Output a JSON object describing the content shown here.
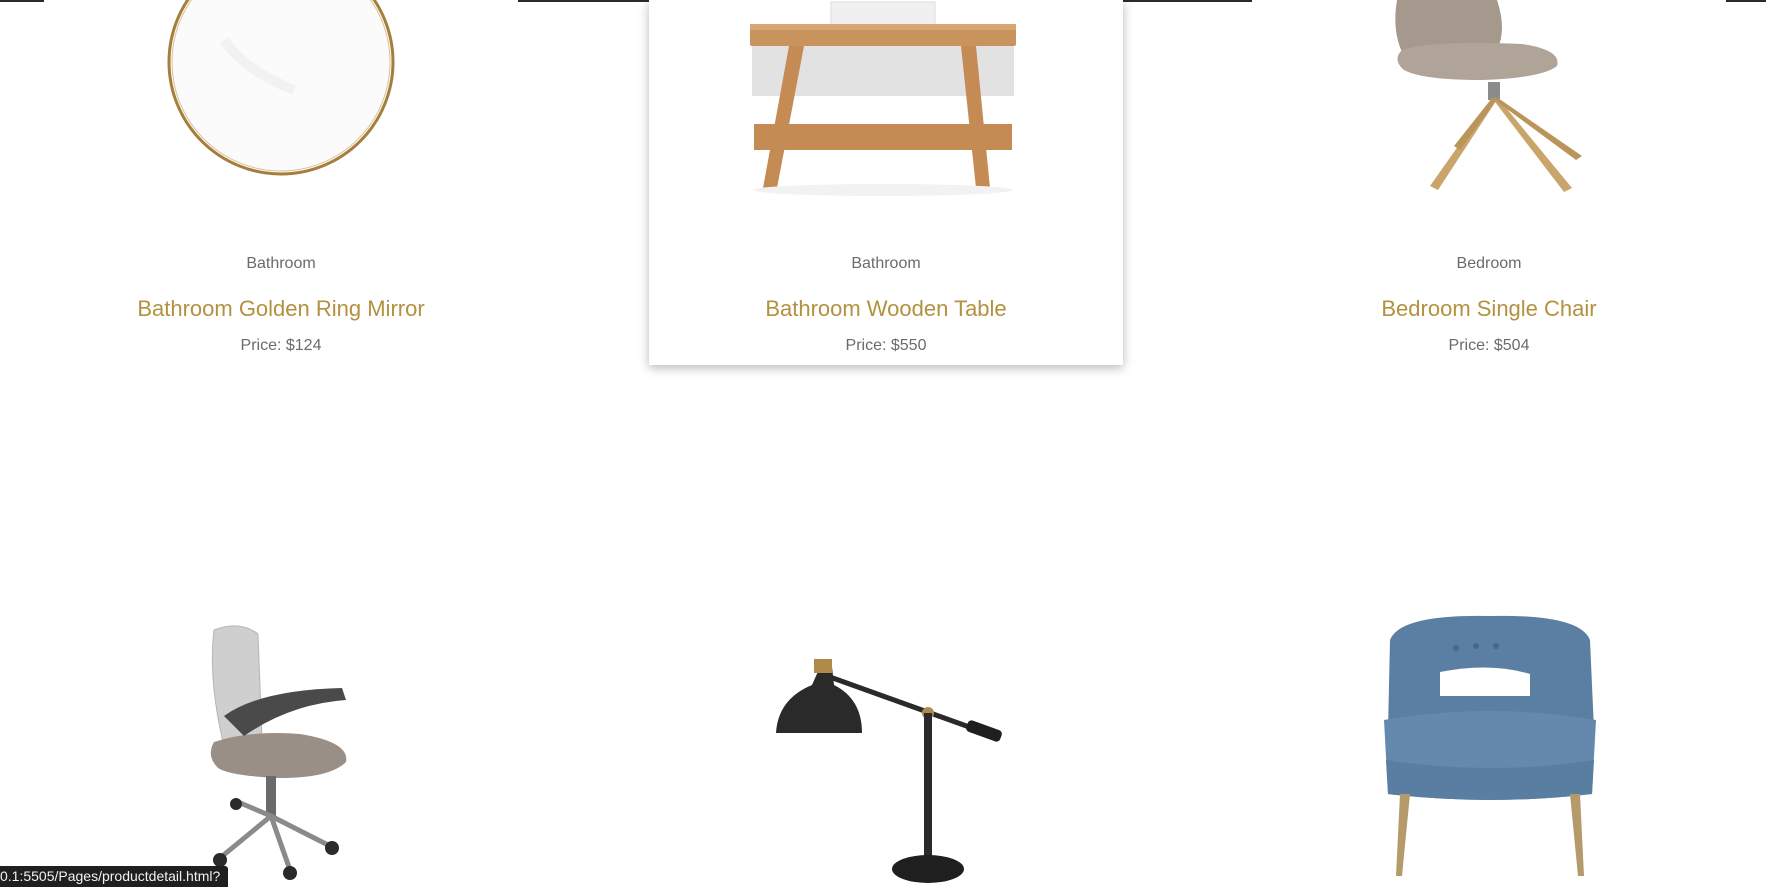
{
  "products": [
    {
      "category": "Bathroom",
      "title": "Bathroom Golden Ring Mirror",
      "price": "Price: $124",
      "image": "golden-ring-mirror"
    },
    {
      "category": "Bathroom",
      "title": "Bathroom Wooden Table",
      "price": "Price: $550",
      "image": "wooden-table"
    },
    {
      "category": "Bedroom",
      "title": "Bedroom Single Chair",
      "price": "Price: $504",
      "image": "single-chair"
    }
  ],
  "row2_products": [
    {
      "image": "office-chair"
    },
    {
      "image": "desk-lamp"
    },
    {
      "image": "blue-armchair"
    }
  ],
  "status_bar": {
    "url": "0.1:5505/Pages/productdetail.html?"
  },
  "colors": {
    "title": "#b3913f",
    "text": "#6b6b6b"
  }
}
